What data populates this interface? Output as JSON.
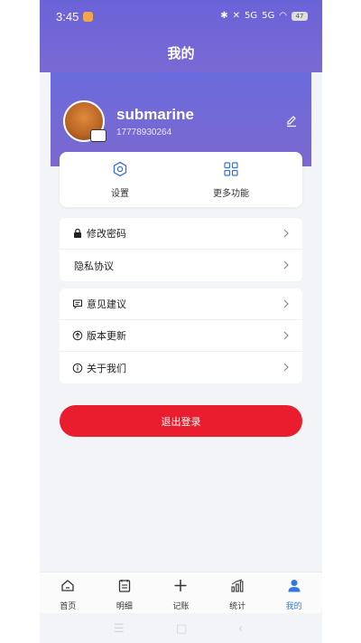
{
  "status_bar": {
    "time": "3:45",
    "network_left": "5G",
    "network_right": "5G",
    "battery": "47"
  },
  "header": {
    "title": "我的"
  },
  "profile": {
    "username": "submarine",
    "phone": "17778930264"
  },
  "quick_actions": [
    {
      "label": "设置",
      "icon": "gear-icon"
    },
    {
      "label": "更多功能",
      "icon": "grid-icon"
    }
  ],
  "menu_group_1": [
    {
      "label": "修改密码",
      "icon": "lock-icon"
    },
    {
      "label": "隐私协议",
      "icon": ""
    }
  ],
  "menu_group_2": [
    {
      "label": "意见建议",
      "icon": "message-icon"
    },
    {
      "label": "版本更新",
      "icon": "arrow-up-circle-icon"
    },
    {
      "label": "关于我们",
      "icon": "info-icon"
    }
  ],
  "logout": {
    "label": "退出登录"
  },
  "tabbar": [
    {
      "label": "首页",
      "icon": "home-icon",
      "active": false
    },
    {
      "label": "明细",
      "icon": "list-icon",
      "active": false
    },
    {
      "label": "记账",
      "icon": "plus-icon",
      "active": false
    },
    {
      "label": "统计",
      "icon": "chart-icon",
      "active": false
    },
    {
      "label": "我的",
      "icon": "user-icon",
      "active": true
    }
  ],
  "colors": {
    "accent": "#3178e4",
    "header": "#6a63d8",
    "logout": "#ea1d2e"
  }
}
